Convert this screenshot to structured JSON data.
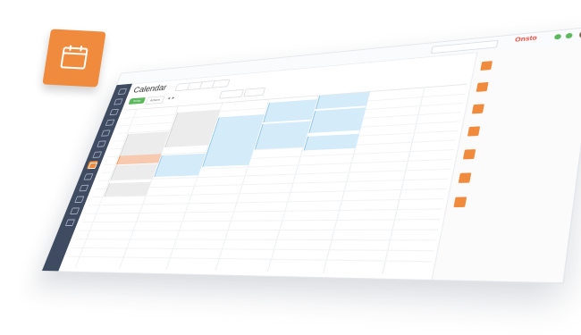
{
  "header": {
    "title": "Calendar",
    "today_label": "Today",
    "actions_label": "Actions"
  },
  "topbar": {
    "brand": "Onsto"
  },
  "colors": {
    "accent": "#f08a3c",
    "sidebar": "#3f4b60",
    "event_blue": "#d4ebf9",
    "event_gray": "#ececec",
    "event_orange": "#f7c9ae",
    "status_green": "#5cb85c"
  },
  "icons": {
    "app_tile": "calendar-icon"
  }
}
